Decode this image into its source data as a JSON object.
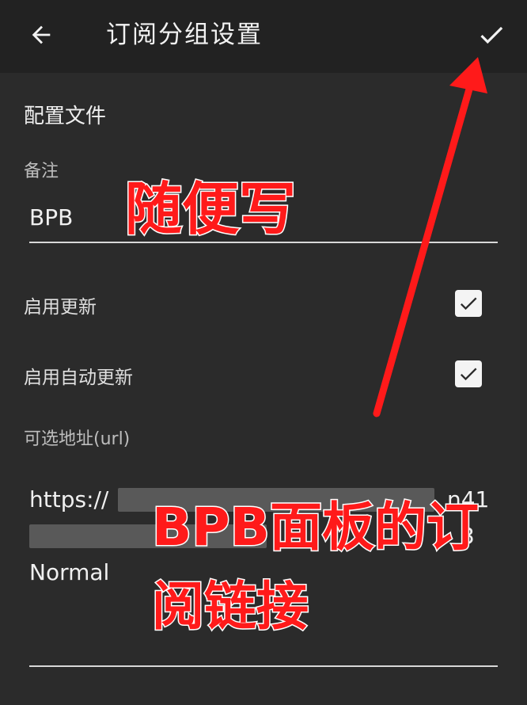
{
  "appbar": {
    "title": "订阅分组设置",
    "back_icon": "arrow-left-icon",
    "confirm_icon": "check-icon"
  },
  "section_title": "配置文件",
  "remark": {
    "label": "备注",
    "value": "BPB"
  },
  "settings": [
    {
      "label": "启用更新",
      "checked": true
    },
    {
      "label": "启用自动更新",
      "checked": true
    }
  ],
  "url_field": {
    "label": "可选地址(url)",
    "line1": "https://",
    "line1_tail": "n41",
    "line2_tail": "3",
    "line3": "Normal"
  },
  "annotations": {
    "remark_note": "随便写",
    "url_note_line1": "BPB面板的订",
    "url_note_line2": "阅链接",
    "color": "#ff1a1a"
  },
  "colors": {
    "background": "#2b2b2b",
    "appbar": "#222222",
    "text": "#f0f0f0",
    "checkbox": "#f4f4f4"
  }
}
